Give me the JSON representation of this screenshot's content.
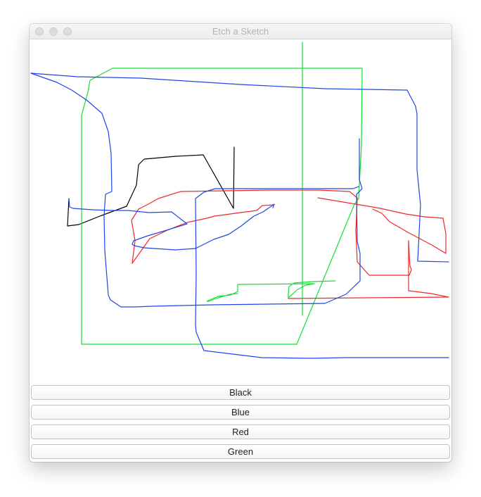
{
  "window": {
    "title": "Etch a Sketch"
  },
  "buttons": [
    {
      "id": "black",
      "label": "Black"
    },
    {
      "id": "blue",
      "label": "Blue"
    },
    {
      "id": "red",
      "label": "Red"
    },
    {
      "id": "green",
      "label": "Green"
    }
  ],
  "colors": {
    "black": "#000000",
    "blue": "#1f45e6",
    "red": "#ee2a2a",
    "green": "#13e034"
  }
}
